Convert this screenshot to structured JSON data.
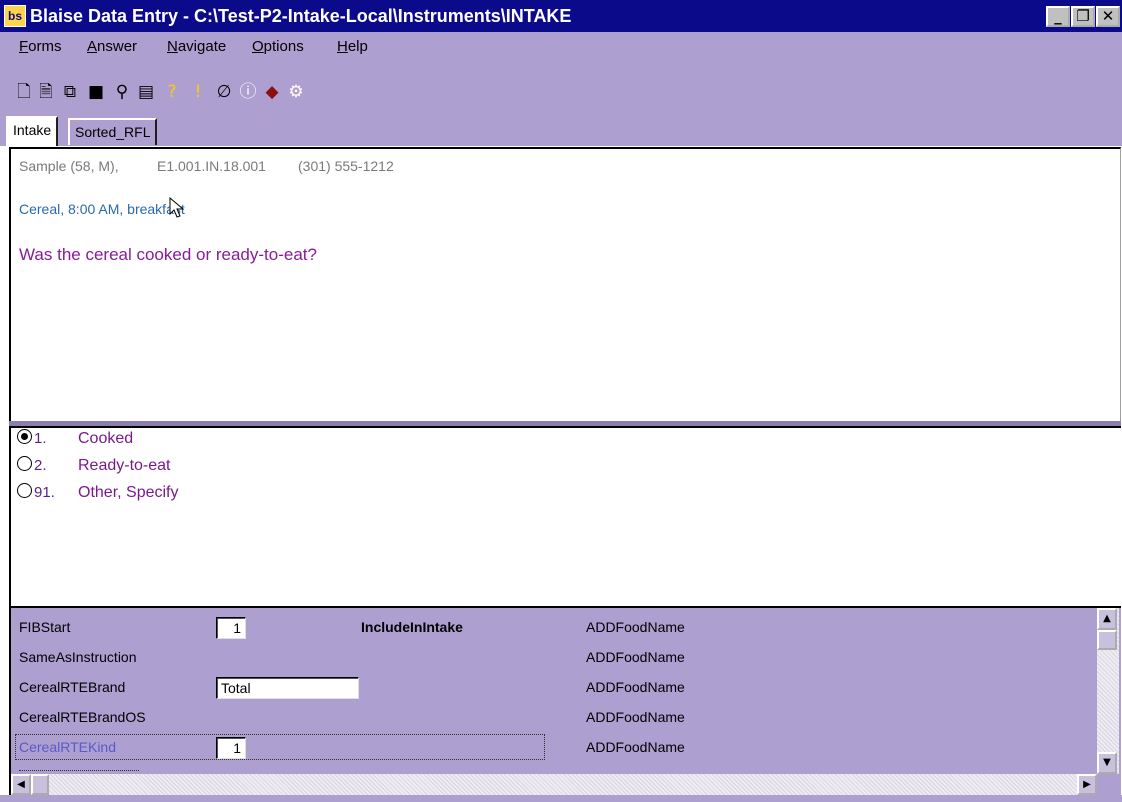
{
  "window": {
    "title": "Blaise Data Entry - C:\\Test-P2-Intake-Local\\Instruments\\INTAKE",
    "icon_label": "bs",
    "minimize_glyph": "_",
    "restore_glyph": "❐",
    "close_glyph": "✕"
  },
  "menu": {
    "items": [
      {
        "first": "F",
        "rest": "orms"
      },
      {
        "first": "A",
        "rest": "nswer"
      },
      {
        "first": "N",
        "rest": "avigate"
      },
      {
        "first": "O",
        "rest": "ptions"
      },
      {
        "first": "H",
        "rest": "elp"
      }
    ]
  },
  "toolbar": {
    "icons": [
      {
        "name": "new-form-icon",
        "glyph": "🗋",
        "color": "#000000"
      },
      {
        "name": "form-icon",
        "glyph": "🗎",
        "color": "#000000"
      },
      {
        "name": "copy-form-icon",
        "glyph": "⧉",
        "color": "#000000"
      },
      {
        "name": "save-icon",
        "glyph": "■",
        "color": "#000000"
      },
      {
        "name": "find-icon",
        "glyph": "⚲",
        "color": "#000000"
      },
      {
        "name": "browse-icon",
        "glyph": "▤",
        "color": "#000000"
      },
      {
        "name": "help-icon",
        "glyph": "?",
        "color": "#ffcc00"
      },
      {
        "name": "error-icon",
        "glyph": "!",
        "color": "#ffcc00"
      },
      {
        "name": "attach-icon",
        "glyph": "∅",
        "color": "#000000"
      },
      {
        "name": "info-icon",
        "glyph": "ⓘ",
        "color": "#ffffff"
      },
      {
        "name": "remark-icon",
        "glyph": "◆",
        "color": "#8a1010"
      },
      {
        "name": "settings-icon",
        "glyph": "⚙",
        "color": "#ffffff"
      }
    ]
  },
  "tabs": [
    {
      "label": "Intake",
      "active": true
    },
    {
      "label": "Sorted_RFL",
      "active": false
    }
  ],
  "question": {
    "header_name": "Sample (58, M),",
    "header_id": "E1.001.IN.18.001",
    "header_phone": "(301) 555-1212",
    "context": "Cereal, 8:00 AM, breakfast",
    "text": "Was the cereal cooked or ready-to-eat?"
  },
  "answers": [
    {
      "code": "1.",
      "label": "Cooked",
      "selected": true
    },
    {
      "code": "2.",
      "label": "Ready-to-eat",
      "selected": false
    },
    {
      "code": "91.",
      "label": "Other, Specify",
      "selected": false
    }
  ],
  "fields": [
    {
      "name": "FIBStart",
      "value": "1",
      "extra_label": "IncludeInIntake",
      "right": "ADDFoodName"
    },
    {
      "name": "SameAsInstruction",
      "value": null,
      "right": "ADDFoodName"
    },
    {
      "name": "CerealRTEBrand",
      "value": "Total",
      "right": "ADDFoodName"
    },
    {
      "name": "CerealRTEBrandOS",
      "value": null,
      "right": "ADDFoodName"
    },
    {
      "name": "CerealRTEKind",
      "value": "1",
      "right": "ADDFoodName",
      "focused": true
    }
  ],
  "scroll": {
    "up_glyph": "▲",
    "down_glyph": "▼",
    "left_glyph": "◀",
    "right_glyph": "▶"
  },
  "colors": {
    "titlebar": "#0a0a8a",
    "panel": "#ad9fd0",
    "question_text": "#8a1a9a",
    "context_text": "#2a6aa8",
    "header_text": "#7a7a7a",
    "focused_field_text": "#5a5ac8"
  }
}
